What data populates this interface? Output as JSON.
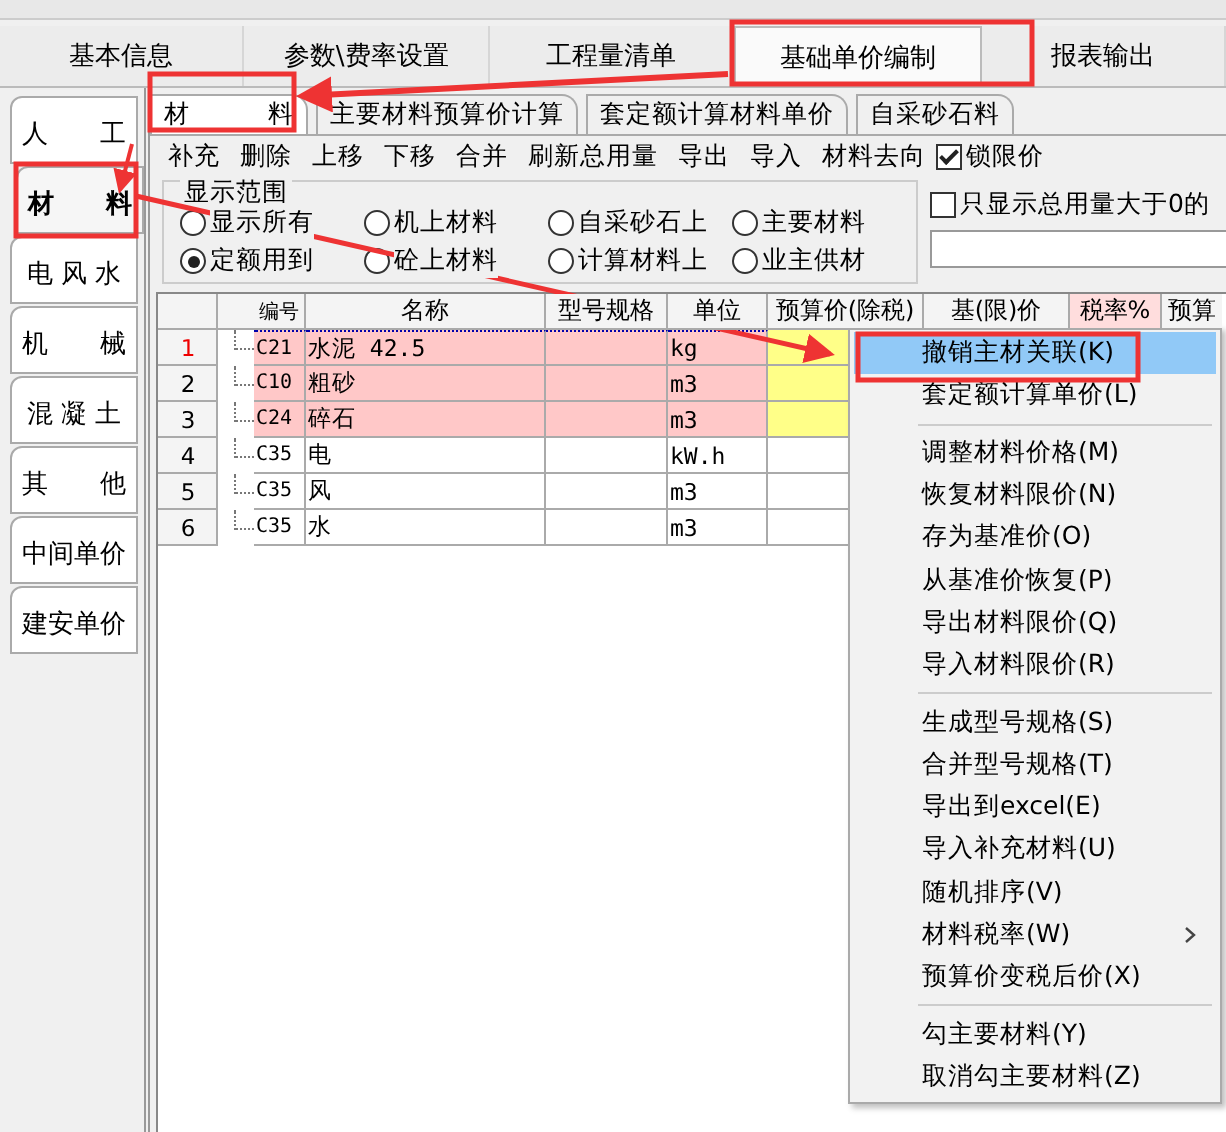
{
  "main_tabs": [
    {
      "label": "基本信息",
      "selected": false
    },
    {
      "label": "参数\\费率设置",
      "selected": false
    },
    {
      "label": "工程量清单",
      "selected": false
    },
    {
      "label": "基础单价编制",
      "selected": true
    },
    {
      "label": "报表输出",
      "selected": false
    }
  ],
  "side_tabs": [
    {
      "label": "人　　工",
      "selected": false
    },
    {
      "label": "材　　料",
      "selected": true
    },
    {
      "label": "电 风 水",
      "selected": false
    },
    {
      "label": "机　　械",
      "selected": false
    },
    {
      "label": "混 凝 土",
      "selected": false
    },
    {
      "label": "其　　他",
      "selected": false
    },
    {
      "label": "中间单价",
      "selected": false
    },
    {
      "label": "建安单价",
      "selected": false
    }
  ],
  "sub_tabs": [
    {
      "label": "材　　　料",
      "selected": true
    },
    {
      "label": "主要材料预算价计算",
      "selected": false
    },
    {
      "label": "套定额计算材料单价",
      "selected": false
    },
    {
      "label": "自采砂石料",
      "selected": false
    }
  ],
  "actions": [
    "补充",
    "删除",
    "上移",
    "下移",
    "合并",
    "刷新总用量",
    "导出",
    "导入",
    "材料去向"
  ],
  "lock_limit": {
    "label": "锁限价",
    "checked": true
  },
  "display_range": {
    "title": "显示范围",
    "options": [
      {
        "label": "显示所有",
        "selected": false
      },
      {
        "label": "机上材料",
        "selected": false
      },
      {
        "label": "自采砂石上",
        "selected": false
      },
      {
        "label": "主要材料",
        "selected": false
      },
      {
        "label": "定额用到",
        "selected": true
      },
      {
        "label": "砼上材料",
        "selected": false
      },
      {
        "label": "计算材料上",
        "selected": false
      },
      {
        "label": "业主供材",
        "selected": false
      }
    ]
  },
  "filter": {
    "label": "只显示总用量大于0的",
    "checked": false
  },
  "table": {
    "columns": [
      "编号",
      "名称",
      "型号规格",
      "单位",
      "预算价(除税)",
      "基(限)价",
      "税率%",
      "预算"
    ],
    "rows": [
      {
        "index": "1",
        "code": "C21",
        "name": "水泥 42.5",
        "unit": "kg",
        "highlighted": true,
        "selected": true
      },
      {
        "index": "2",
        "code": "C10",
        "name": "粗砂",
        "unit": "m3",
        "highlighted": true,
        "selected": false
      },
      {
        "index": "3",
        "code": "C24",
        "name": "碎石",
        "unit": "m3",
        "highlighted": true,
        "selected": false
      },
      {
        "index": "4",
        "code": "C35",
        "name": "电",
        "unit": "kW.h",
        "highlighted": false,
        "selected": false
      },
      {
        "index": "5",
        "code": "C35",
        "name": "风",
        "unit": "m3",
        "highlighted": false,
        "selected": false
      },
      {
        "index": "6",
        "code": "C35",
        "name": "水",
        "unit": "m3",
        "highlighted": false,
        "selected": false
      }
    ]
  },
  "context_menu": {
    "items": [
      {
        "kind": "item",
        "label": "撤销主材关联(K)",
        "selected": true
      },
      {
        "kind": "item",
        "label": "套定额计算单价(L)",
        "selected": false
      },
      {
        "kind": "separator"
      },
      {
        "kind": "item",
        "label": "调整材料价格(M)",
        "selected": false
      },
      {
        "kind": "item",
        "label": "恢复材料限价(N)",
        "selected": false
      },
      {
        "kind": "item",
        "label": "存为基准价(O)",
        "selected": false
      },
      {
        "kind": "item",
        "label": "从基准价恢复(P)",
        "selected": false
      },
      {
        "kind": "item",
        "label": "导出材料限价(Q)",
        "selected": false
      },
      {
        "kind": "item",
        "label": "导入材料限价(R)",
        "selected": false
      },
      {
        "kind": "separator"
      },
      {
        "kind": "item",
        "label": "生成型号规格(S)",
        "selected": false
      },
      {
        "kind": "item",
        "label": "合并型号规格(T)",
        "selected": false
      },
      {
        "kind": "item",
        "label": "导出到excel(E)",
        "selected": false
      },
      {
        "kind": "item",
        "label": "导入补充材料(U)",
        "selected": false
      },
      {
        "kind": "item",
        "label": "随机排序(V)",
        "selected": false
      },
      {
        "kind": "submenu",
        "label": "材料税率(W)",
        "selected": false
      },
      {
        "kind": "item",
        "label": "预算价变税后价(X)",
        "selected": false
      },
      {
        "kind": "separator"
      },
      {
        "kind": "item",
        "label": "勾主要材料(Y)",
        "selected": false
      },
      {
        "kind": "item",
        "label": "取消勾主要材料(Z)",
        "selected": false
      }
    ]
  }
}
